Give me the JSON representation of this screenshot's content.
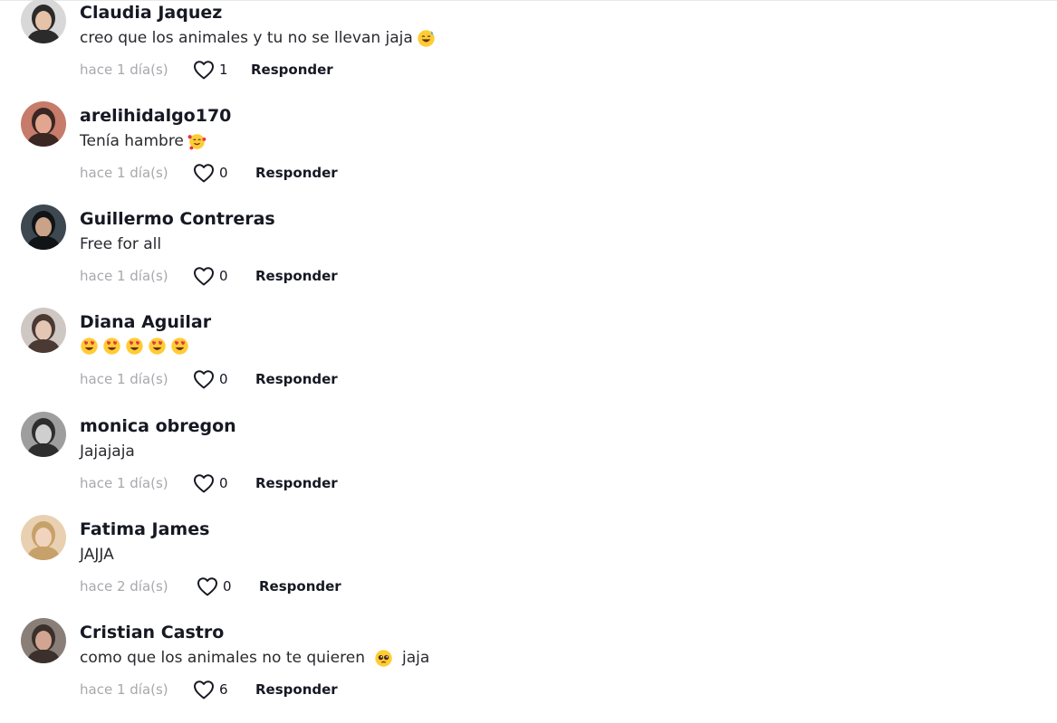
{
  "comments": [
    {
      "username": "Claudia Jaquez",
      "text": "creo que los animales y tu no se llevan jaja",
      "emojis": [
        "grinning-sweat-emoji"
      ],
      "after_text": "",
      "time": "hace 1 día(s)",
      "likes": "1",
      "reply_label": "Responder",
      "avatar_colors": [
        "#d8d8d8",
        "#2b2b2b",
        "#e6c2a8"
      ]
    },
    {
      "username": "arelihidalgo170",
      "text": "Tenía hambre",
      "emojis": [
        "smiling-hearts-emoji"
      ],
      "after_text": "",
      "time": "hace 1 día(s)",
      "likes": "0",
      "reply_label": "Responder",
      "avatar_colors": [
        "#c77b6a",
        "#3a2622",
        "#e2a590"
      ]
    },
    {
      "username": "Guillermo Contreras",
      "text": "Free for all",
      "emojis": [],
      "after_text": "",
      "time": "hace 1 día(s)",
      "likes": "0",
      "reply_label": "Responder",
      "avatar_colors": [
        "#3d4850",
        "#111417",
        "#c9a288"
      ]
    },
    {
      "username": "Diana Aguilar",
      "text": "",
      "emojis": [
        "heart-eyes-emoji",
        "heart-eyes-emoji",
        "heart-eyes-emoji",
        "heart-eyes-emoji",
        "heart-eyes-emoji"
      ],
      "after_text": "",
      "time": "hace 1 día(s)",
      "likes": "0",
      "reply_label": "Responder",
      "avatar_colors": [
        "#cfc7c4",
        "#4a3a33",
        "#e4c6b4"
      ]
    },
    {
      "username": "monica obregon",
      "text": "Jajajaja",
      "emojis": [],
      "after_text": "",
      "time": "hace 1 día(s)",
      "likes": "0",
      "reply_label": "Responder",
      "avatar_colors": [
        "#9e9e9e",
        "#2e2e2e",
        "#cfcfcf"
      ]
    },
    {
      "username": "Fatima James",
      "text": "JAJJA",
      "emojis": [],
      "after_text": "",
      "time": "hace 2 día(s)",
      "likes": "0",
      "reply_label": "Responder",
      "avatar_colors": [
        "#e9d0b0",
        "#c7a16a",
        "#f1d4be"
      ]
    },
    {
      "username": "Cristian Castro",
      "text": "como que los animales no te quieren",
      "emojis": [
        "pleading-face-emoji"
      ],
      "after_text": "jaja",
      "time": "hace 1 día(s)",
      "likes": "6",
      "reply_label": "Responder",
      "avatar_colors": [
        "#8a7f78",
        "#3b302b",
        "#d1a591"
      ]
    }
  ],
  "colors": {
    "username": "#161823",
    "text": "#2a2a2f",
    "time": "#a8a8ad",
    "heart_outline": "#161823",
    "emoji_face": "#ffcc33"
  }
}
